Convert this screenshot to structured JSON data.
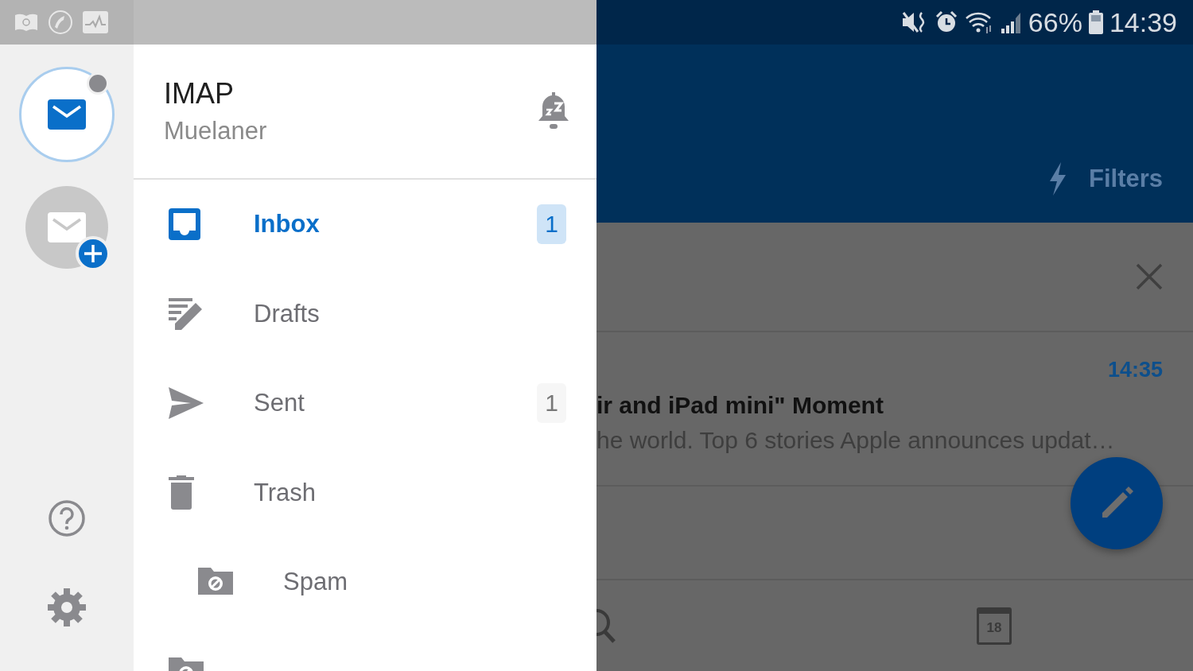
{
  "status_bar": {
    "battery": "66%",
    "time": "14:39"
  },
  "accounts": [
    {
      "kind": "account",
      "selected": true
    },
    {
      "kind": "add",
      "selected": false
    }
  ],
  "account_header": {
    "title": "IMAP",
    "subtitle": "Muelaner"
  },
  "folders": [
    {
      "kind": "inbox",
      "label": "Inbox",
      "count": "1",
      "selected": true
    },
    {
      "kind": "drafts",
      "label": "Drafts",
      "selected": false
    },
    {
      "kind": "sent",
      "label": "Sent",
      "count": "1",
      "selected": false
    },
    {
      "kind": "trash",
      "label": "Trash",
      "selected": false,
      "children": [
        {
          "kind": "spam",
          "label": "Spam",
          "selected": false
        }
      ]
    },
    {
      "kind": "spam",
      "selected": false
    }
  ],
  "mail": {
    "filters": "Filters",
    "message": {
      "time": "14:35",
      "subject": "ir and iPad mini\" Moment",
      "preview": "he world. Top 6 stories Apple announces updat…"
    },
    "calendar_day": "18"
  }
}
